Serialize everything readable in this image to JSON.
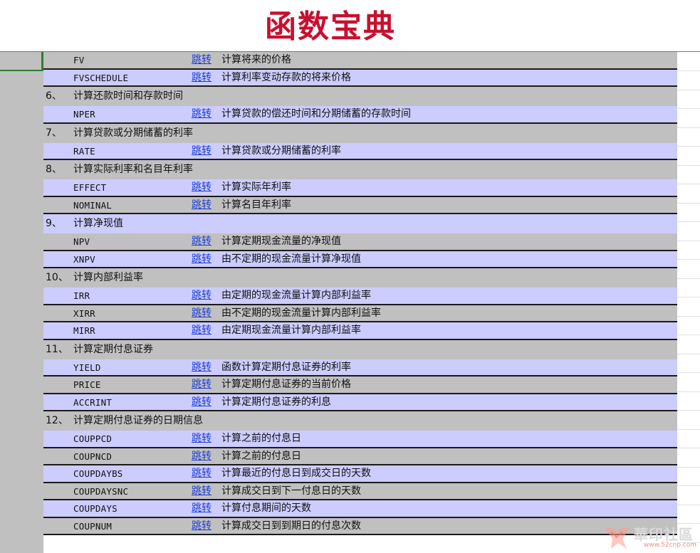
{
  "title": "函数宝典",
  "jump_label": "跳转",
  "rows": [
    {
      "kind": "func",
      "shade": "gray",
      "name": "FV",
      "desc": "计算将来的价格"
    },
    {
      "kind": "func",
      "shade": "blue",
      "name": "FVSCHEDULE",
      "desc": "计算利率变动存款的将来价格"
    },
    {
      "kind": "section",
      "num": "6、",
      "text": "计算还款时间和存款时间"
    },
    {
      "kind": "func",
      "shade": "blue",
      "name": "NPER",
      "desc": "计算贷款的偿还时间和分期储蓄的存款时间"
    },
    {
      "kind": "section",
      "num": "7、",
      "text": "计算贷款或分期储蓄的利率"
    },
    {
      "kind": "func",
      "shade": "blue",
      "name": "RATE",
      "desc": "计算贷款或分期储蓄的利率"
    },
    {
      "kind": "section",
      "num": "8、",
      "text": "计算实际利率和名目年利率"
    },
    {
      "kind": "func",
      "shade": "blue",
      "name": "EFFECT",
      "desc": "计算实际年利率"
    },
    {
      "kind": "func",
      "shade": "gray",
      "name": "NOMINAL",
      "desc": "计算名目年利率"
    },
    {
      "kind": "section-blue",
      "num": "9、",
      "text": "计算净现值"
    },
    {
      "kind": "func",
      "shade": "gray",
      "name": "NPV",
      "desc": "计算定期现金流量的净现值"
    },
    {
      "kind": "func",
      "shade": "blue",
      "name": "XNPV",
      "desc": "由不定期的现金流量计算净现值"
    },
    {
      "kind": "section",
      "num": "10、",
      "text": "计算内部利益率"
    },
    {
      "kind": "func",
      "shade": "blue",
      "name": "IRR",
      "desc": "由定期的现金流量计算内部利益率"
    },
    {
      "kind": "func",
      "shade": "gray",
      "name": "XIRR",
      "desc": "由不定期的现金流量计算内部利益率"
    },
    {
      "kind": "func",
      "shade": "blue",
      "name": "MIRR",
      "desc": "由定期现金流量计算内部利益率"
    },
    {
      "kind": "section",
      "num": "11、",
      "text": "计算定期付息证券"
    },
    {
      "kind": "func",
      "shade": "blue",
      "name": "YIELD",
      "desc": "函数计算定期付息证券的利率"
    },
    {
      "kind": "func",
      "shade": "gray",
      "name": "PRICE",
      "desc": "计算定期付息证券的当前价格"
    },
    {
      "kind": "func",
      "shade": "blue",
      "name": "ACCRINT",
      "desc": "计算定期付息证券的利息"
    },
    {
      "kind": "section",
      "num": "12、",
      "text": "计算定期付息证券的日期信息"
    },
    {
      "kind": "func",
      "shade": "blue",
      "name": "COUPPCD",
      "desc": "计算之前的付息日"
    },
    {
      "kind": "func",
      "shade": "gray",
      "name": "COUPNCD",
      "desc": "计算之前的付息日"
    },
    {
      "kind": "func",
      "shade": "blue",
      "name": "COUPDAYBS",
      "desc": "计算最近的付息日到成交日的天数"
    },
    {
      "kind": "func",
      "shade": "gray",
      "name": "COUPDAYSNC",
      "desc": "计算成交日到下一付息日的天数"
    },
    {
      "kind": "func",
      "shade": "blue",
      "name": "COUPDAYS",
      "desc": "计算付息期间的天数"
    },
    {
      "kind": "func",
      "shade": "gray",
      "name": "COUPNUM",
      "desc": "计算成交日到到期日的付息次数"
    }
  ],
  "watermark": {
    "text": "華印社區",
    "url": "www.52cnp.com"
  },
  "colors": {
    "title": "#c8102e",
    "row_gray": "#c0c0c0",
    "row_blue": "#ccccff",
    "link": "#1a3cd6"
  }
}
